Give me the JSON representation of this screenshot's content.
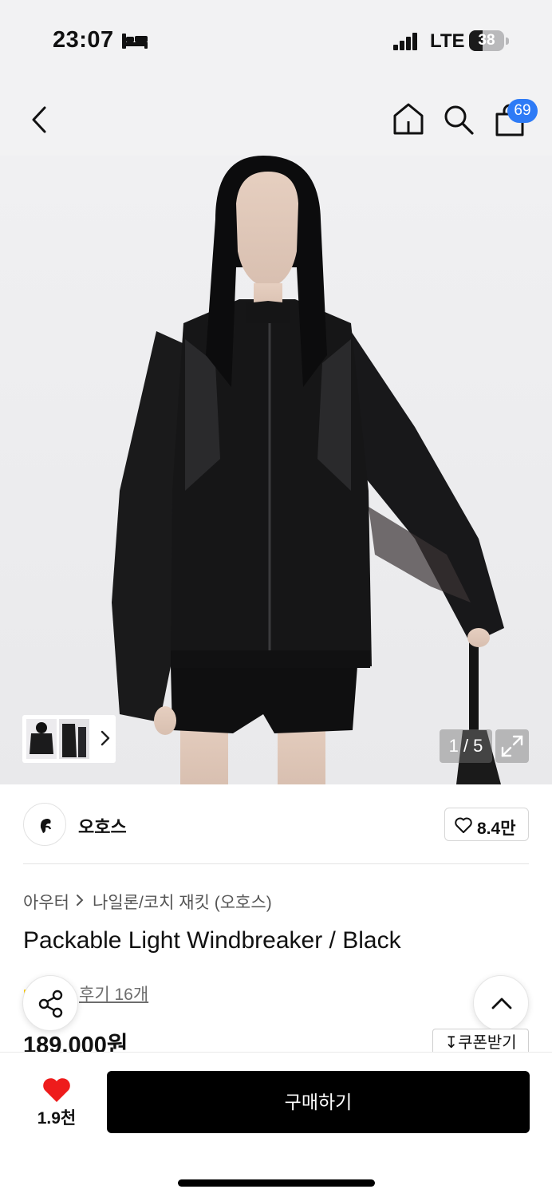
{
  "status_bar": {
    "time": "23:07",
    "network": "LTE",
    "battery": "38",
    "battery_level": 0.38
  },
  "header": {
    "icons": [
      "back-arrow-icon",
      "home-icon",
      "search-icon",
      "shopping-bag-icon"
    ],
    "cart_count": "69"
  },
  "gallery": {
    "counter": "1 / 5",
    "current_image": 1,
    "total_images": 5,
    "expand_icon": "expand-icon"
  },
  "brand": {
    "name": "오호스",
    "likes": "8.4만"
  },
  "product": {
    "category": "아우터",
    "subcategory": "나일론/코치 재킷 (오호스)",
    "title": "Packable Light Windbreaker / Black",
    "reviews": "후기 16개",
    "price": "189,000원",
    "coupon": "쿠폰받기"
  },
  "bottom_bar": {
    "wish_count": "1.9천",
    "buy_label": "구매하기"
  },
  "colors": {
    "accent_blue": "#2e7bf6",
    "heart_red": "#ee1c1c",
    "buy_button": "#000000"
  }
}
